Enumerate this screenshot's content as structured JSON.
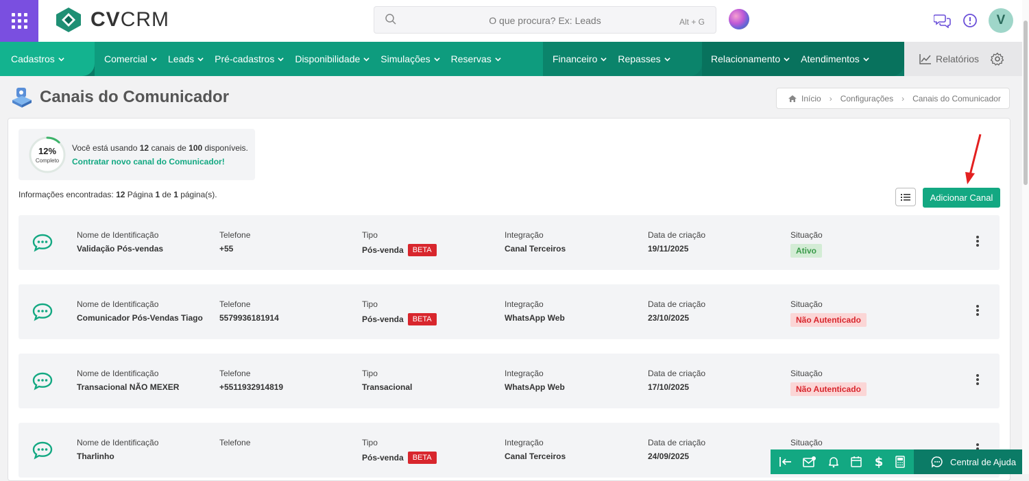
{
  "header": {
    "logo_text_bold": "CV",
    "logo_text": "CRM",
    "search_placeholder": "O que procura? Ex: Leads",
    "search_shortcut": "Alt + G",
    "avatar_initial": "V",
    "accent_color": "#13a882",
    "apps_color": "#7a4fe0"
  },
  "nav": {
    "items_group1": [
      "Cadastros"
    ],
    "items_group2": [
      "Comercial",
      "Leads",
      "Pré-cadastros",
      "Disponibilidade",
      "Simulações",
      "Reservas"
    ],
    "items_group3": [
      "Financeiro",
      "Repasses"
    ],
    "items_group4": [
      "Relacionamento",
      "Atendimentos"
    ],
    "reports_label": "Relatórios"
  },
  "page": {
    "title": "Canais do Comunicador",
    "breadcrumb": [
      "Início",
      "Configurações",
      "Canais do Comunicador"
    ]
  },
  "usage": {
    "percent": "12%",
    "percent_value": 0.12,
    "sub": "Completo",
    "text_prefix": "Você está usando ",
    "used": "12",
    "text_mid": " canais de ",
    "total": "100",
    "text_suffix": " disponíveis.",
    "link": "Contratar novo canal do Comunicador!"
  },
  "results": {
    "prefix": "Informações encontradas: ",
    "count": "12",
    "page_label": " Página ",
    "page": "1",
    "of_label": " de ",
    "pages": "1",
    "suffix": " página(s)."
  },
  "actions": {
    "add_button": "Adicionar Canal"
  },
  "columns": {
    "name": "Nome de Identificação",
    "phone": "Telefone",
    "type": "Tipo",
    "integration": "Integração",
    "created": "Data de criação",
    "status": "Situação"
  },
  "channels": [
    {
      "name": "Validação Pós-vendas",
      "phone": "+55",
      "type": "Pós-venda",
      "beta": "BETA",
      "integration": "Canal Terceiros",
      "created": "19/11/2025",
      "status": "Ativo",
      "status_kind": "ok"
    },
    {
      "name": "Comunicador Pós-Vendas Tiago",
      "phone": "5579936181914",
      "type": "Pós-venda",
      "beta": "BETA",
      "integration": "WhatsApp Web",
      "created": "23/10/2025",
      "status": "Não Autenticado",
      "status_kind": "no"
    },
    {
      "name": "Transacional NÃO MEXER",
      "phone": "+5511932914819",
      "type": "Transacional",
      "beta": "",
      "integration": "WhatsApp Web",
      "created": "17/10/2025",
      "status": "Não Autenticado",
      "status_kind": "no"
    },
    {
      "name": "Tharlinho",
      "phone": "",
      "type": "Pós-venda",
      "beta": "BETA",
      "integration": "Canal Terceiros",
      "created": "24/09/2025",
      "status": "",
      "status_kind": ""
    }
  ],
  "bottom": {
    "help_label": "Central de Ajuda"
  }
}
